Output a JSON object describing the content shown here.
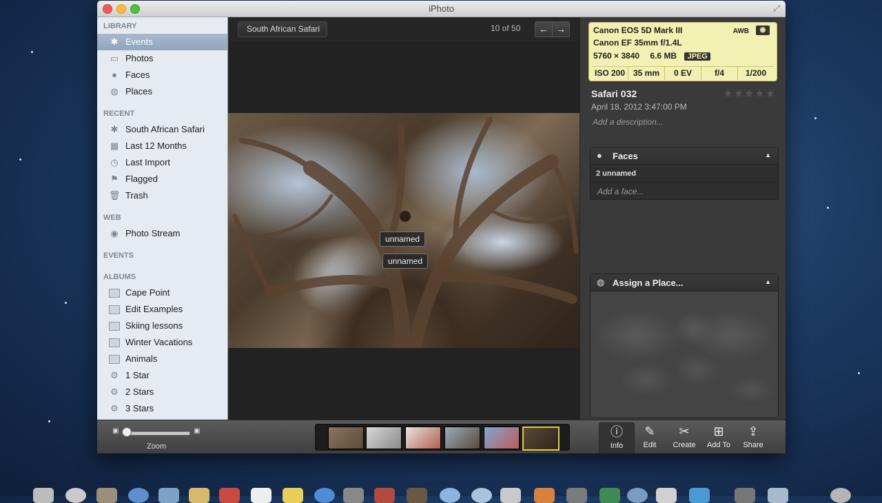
{
  "window": {
    "title": "iPhoto"
  },
  "sidebar": {
    "library_header": "LIBRARY",
    "library": [
      {
        "label": "Events",
        "icon": "palm-tree-icon",
        "selected": true
      },
      {
        "label": "Photos",
        "icon": "photos-icon"
      },
      {
        "label": "Faces",
        "icon": "person-icon"
      },
      {
        "label": "Places",
        "icon": "globe-icon"
      }
    ],
    "recent_header": "RECENT",
    "recent": [
      {
        "label": "South African Safari",
        "icon": "palm-tree-icon"
      },
      {
        "label": "Last 12 Months",
        "icon": "calendar-icon"
      },
      {
        "label": "Last Import",
        "icon": "clock-icon"
      },
      {
        "label": "Flagged",
        "icon": "flag-icon"
      },
      {
        "label": "Trash",
        "icon": "trash-icon"
      }
    ],
    "web_header": "WEB",
    "web": [
      {
        "label": "Photo Stream",
        "icon": "photo-stream-icon"
      }
    ],
    "events_header": "EVENTS",
    "albums_header": "ALBUMS",
    "albums": [
      {
        "label": "Cape Point",
        "icon": "album-icon"
      },
      {
        "label": "Edit Examples",
        "icon": "album-icon"
      },
      {
        "label": "Skiing lessons",
        "icon": "album-icon"
      },
      {
        "label": "Winter Vacations",
        "icon": "album-icon"
      },
      {
        "label": "Animals",
        "icon": "album-icon"
      },
      {
        "label": "1 Star",
        "icon": "smart-album-gear-icon"
      },
      {
        "label": "2 Stars",
        "icon": "smart-album-gear-icon"
      },
      {
        "label": "3 Stars",
        "icon": "smart-album-gear-icon"
      }
    ]
  },
  "topbar": {
    "breadcrumb": "South African Safari",
    "counter": "10 of 50"
  },
  "photo": {
    "face_labels": [
      "unnamed",
      "unnamed"
    ]
  },
  "info": {
    "camera": "Canon EOS 5D Mark III",
    "lens": "Canon EF 35mm f/1.4L",
    "dimensions": "5760 × 3840",
    "size": "6.6 MB",
    "format": "JPEG",
    "awb": "AWB",
    "exif": [
      "ISO 200",
      "35 mm",
      "0 EV",
      "f/4",
      "1/200"
    ],
    "title": "Safari 032",
    "rating_stars": "★★★★★",
    "rating": 0,
    "date": "April 18, 2012 3:47:00 PM",
    "description_placeholder": "Add a description...",
    "faces_panel": {
      "title": "Faces",
      "count": "2 unnamed",
      "add": "Add a face..."
    },
    "places_panel": {
      "title": "Assign a Place..."
    }
  },
  "toolbar": {
    "zoom_label": "Zoom",
    "zoom_level": 0,
    "tools": [
      {
        "label": "Info",
        "icon": "info-icon",
        "active": true
      },
      {
        "label": "Edit",
        "icon": "pencil-icon"
      },
      {
        "label": "Create",
        "icon": "create-icon"
      },
      {
        "label": "Add To",
        "icon": "plus-icon"
      },
      {
        "label": "Share",
        "icon": "share-icon"
      }
    ]
  },
  "colors": {
    "accent_selected": "#91a5c0",
    "exif_bg": "#f3f0b4"
  }
}
